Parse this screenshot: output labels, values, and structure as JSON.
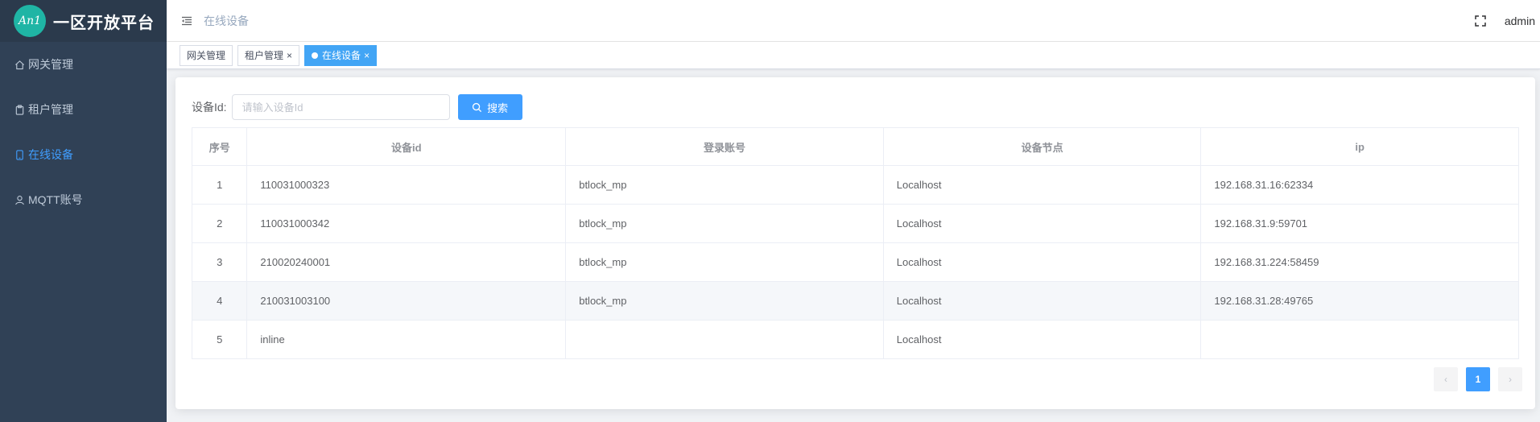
{
  "sidebar": {
    "logo_mark": "An1",
    "title": "一区开放平台",
    "items": [
      {
        "label": "网关管理",
        "icon": "home-icon"
      },
      {
        "label": "租户管理",
        "icon": "clipboard-icon"
      },
      {
        "label": "在线设备",
        "icon": "device-icon"
      },
      {
        "label": "MQTT账号",
        "icon": "user-icon"
      }
    ]
  },
  "header": {
    "breadcrumb": "在线设备",
    "user": "admin"
  },
  "tags": [
    {
      "label": "网关管理"
    },
    {
      "label": "租户管理",
      "close": "×"
    },
    {
      "label": "在线设备",
      "close": "×"
    }
  ],
  "search": {
    "label": "设备Id:",
    "placeholder": "请输入设备Id",
    "button": "搜索"
  },
  "table": {
    "headers": [
      "序号",
      "设备id",
      "登录账号",
      "设备节点",
      "ip"
    ],
    "rows": [
      [
        "1",
        "110031000323",
        "btlock_mp",
        "Localhost",
        "192.168.31.16:62334"
      ],
      [
        "2",
        "110031000342",
        "btlock_mp",
        "Localhost",
        "192.168.31.9:59701"
      ],
      [
        "3",
        "210020240001",
        "btlock_mp",
        "Localhost",
        "192.168.31.224:58459"
      ],
      [
        "4",
        "210031003100",
        "btlock_mp",
        "Localhost",
        "192.168.31.28:49765"
      ],
      [
        "5",
        "inline",
        "",
        "Localhost",
        ""
      ]
    ]
  },
  "pagination": {
    "prev": "‹",
    "page": "1",
    "next": "›"
  },
  "colors": {
    "sidebar_bg": "#304156",
    "accent": "#409eff",
    "logo_circle": "#1fb5a5"
  }
}
